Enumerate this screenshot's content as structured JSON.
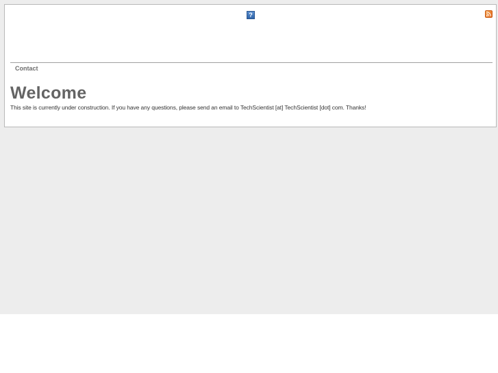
{
  "header": {
    "help_icon": "help-icon",
    "help_glyph": "?",
    "rss_icon": "rss-feed-icon"
  },
  "nav": {
    "items": [
      {
        "label": "Contact"
      }
    ]
  },
  "main": {
    "title": "Welcome",
    "body": "This site is currently under construction. If you have any questions, please send an email to TechScientist [at] TechScientist [dot] com. Thanks!"
  },
  "colors": {
    "page_background": "#ededed",
    "box_border": "#b8b8b8",
    "title_text": "#646464",
    "nav_text": "#6e6e6e",
    "rss_orange": "#e2661c",
    "help_blue": "#2f64a8"
  }
}
